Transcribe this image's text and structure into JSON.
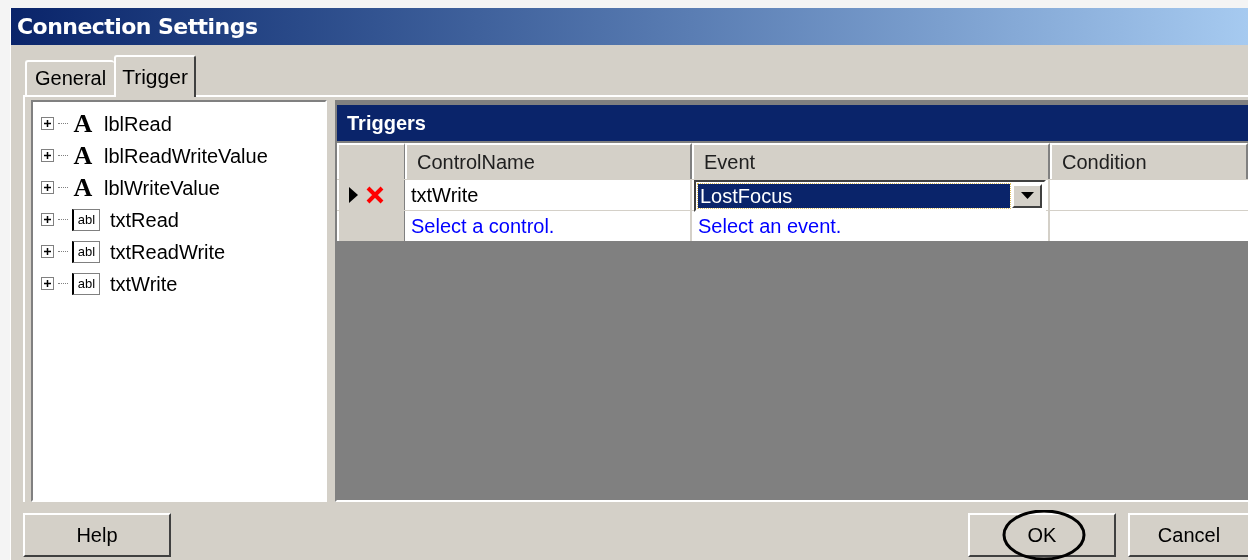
{
  "window": {
    "title": "Connection Settings"
  },
  "tabs": [
    {
      "label": "General",
      "selected": false
    },
    {
      "label": "Trigger",
      "selected": true
    }
  ],
  "tree": [
    {
      "label": "lblRead",
      "kind": "label",
      "icon_text": "A",
      "expanded": false
    },
    {
      "label": "lblReadWriteValue",
      "kind": "label",
      "icon_text": "A",
      "expanded": false
    },
    {
      "label": "lblWriteValue",
      "kind": "label",
      "icon_text": "A",
      "expanded": false
    },
    {
      "label": "txtRead",
      "kind": "textbox",
      "icon_text": "abl",
      "expanded": false
    },
    {
      "label": "txtReadWrite",
      "kind": "textbox",
      "icon_text": "abl",
      "expanded": false
    },
    {
      "label": "txtWrite",
      "kind": "textbox",
      "icon_text": "abl",
      "expanded": false
    }
  ],
  "triggers": {
    "title": "Triggers",
    "columns": [
      "ControlName",
      "Event",
      "Condition"
    ],
    "rows": [
      {
        "kind": "entry",
        "selected": true,
        "control": "txtWrite",
        "event": "LostFocus"
      },
      {
        "kind": "new",
        "selected": false,
        "control": "Select a control.",
        "event": "Select an event."
      }
    ]
  },
  "buttons": [
    {
      "label": "Help",
      "circled": false
    },
    {
      "label": "OK",
      "circled": true
    },
    {
      "label": "Cancel",
      "circled": false
    }
  ]
}
